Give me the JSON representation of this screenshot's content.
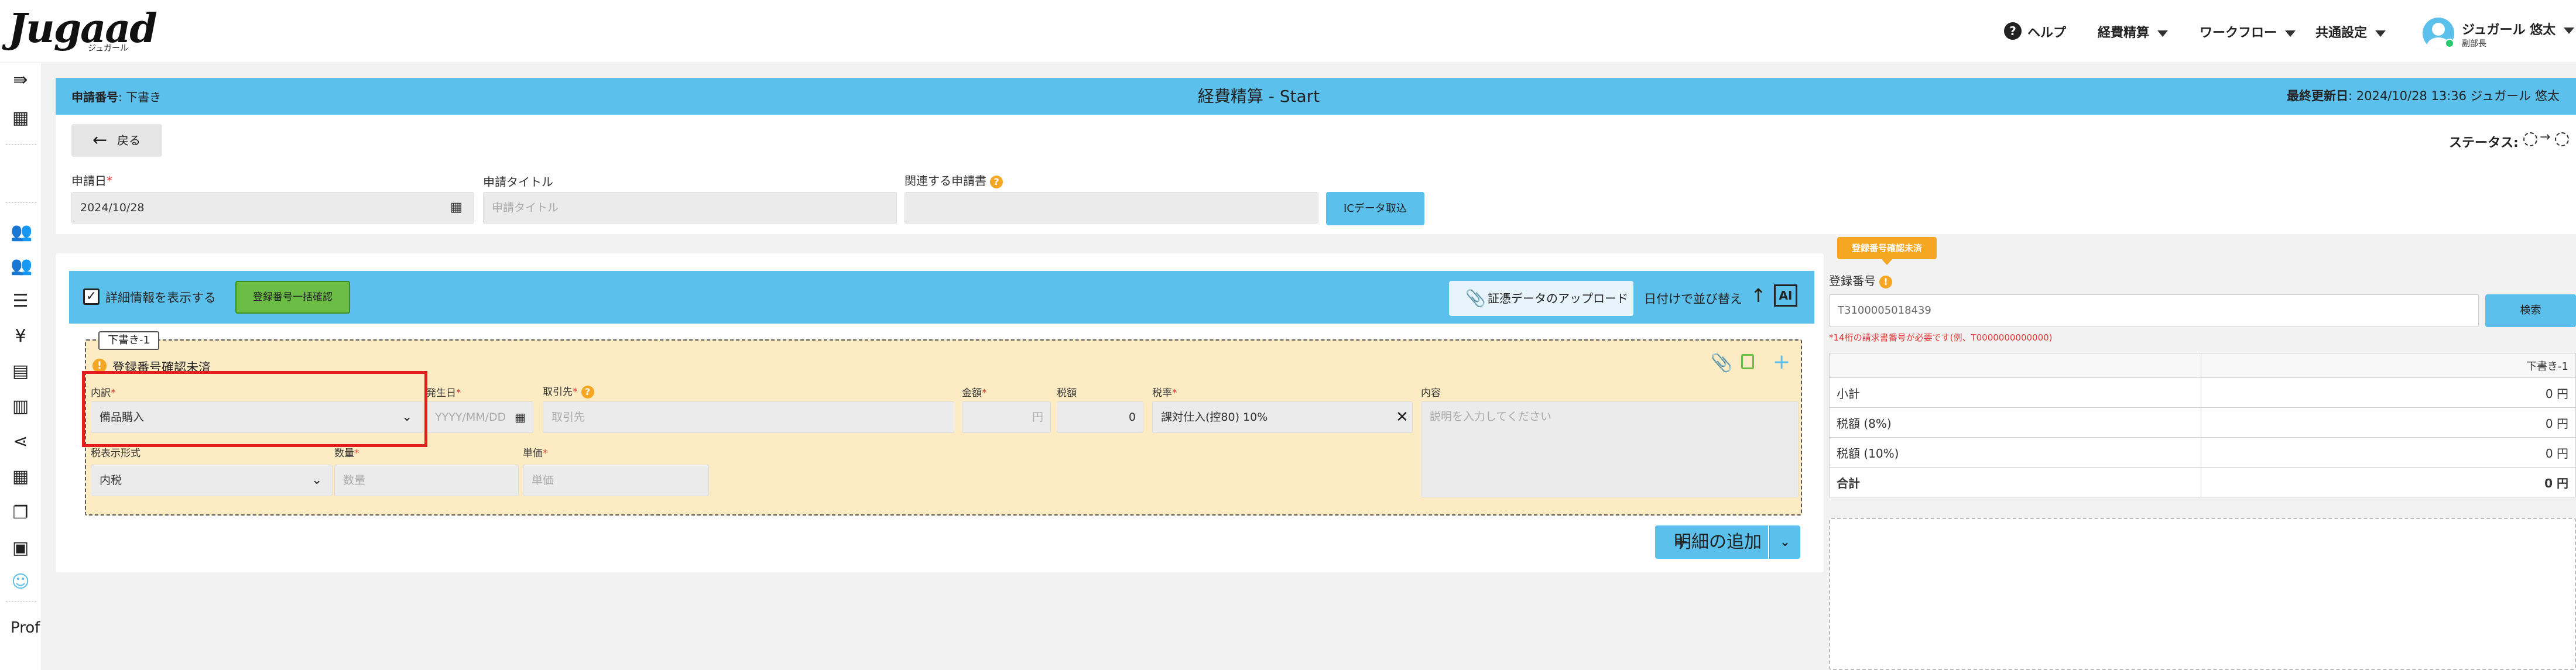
{
  "topbar": {
    "logo_text": "Jugaad",
    "logo_sub": "ジュガール",
    "help_label": "ヘルプ",
    "nav": [
      "経費精算",
      "ワークフロー",
      "共通設定"
    ],
    "user_name": "ジュガール 悠太",
    "user_dept": "副部長"
  },
  "sidebar": {
    "icons": [
      "collapse-icon",
      "building-icon",
      "users-icon",
      "users-icon",
      "list-icon",
      "yen-icon",
      "document-icon",
      "document-stack-icon",
      "share-icon",
      "grid-icon",
      "copy-icon",
      "book-icon",
      "smile-icon"
    ],
    "bottom_text": "Prof"
  },
  "header": {
    "app_no_label": "申請番号",
    "app_no_value": ": 下書き",
    "title": "経費精算 - Start",
    "updated_label": "最終更新日",
    "updated_value": ": 2024/10/28 13:36 ジュガール 悠太"
  },
  "top_form": {
    "back_label": "戻る",
    "status_label": "ステータス:",
    "date_label": "申請日",
    "date_value": "2024/10/28",
    "title_label": "申請タイトル",
    "title_placeholder": "申請タイトル",
    "related_label": "関連する申請書",
    "ic_button": "ICデータ取込"
  },
  "detail": {
    "show_detail_label": "詳細情報を表示する",
    "bulk_confirm_label": "登録番号一括確認",
    "upload_label": "証憑データのアップロード",
    "sort_label": "日付けで並び替え",
    "ai_label": "AI",
    "draft_tag": "下書き-1",
    "warning_text": "登録番号確認未済",
    "fields": {
      "category_label": "内訳",
      "category_value": "備品購入",
      "issue_date_label": "発生日",
      "issue_date_placeholder": "YYYY/MM/DD",
      "vendor_label": "取引先",
      "vendor_placeholder": "取引先",
      "amount_label": "金額",
      "amount_placeholder": "円",
      "tax_label": "税額",
      "tax_value": "0",
      "rate_label": "税率",
      "rate_value": "課対仕入(控80) 10%",
      "content_label": "内容",
      "content_placeholder": "説明を入力してください",
      "tax_display_label": "税表示形式",
      "tax_display_value": "内税",
      "qty_label": "数量",
      "qty_placeholder": "数量",
      "unit_label": "単価",
      "unit_placeholder": "単価"
    },
    "add_line_label": "明細の追加"
  },
  "right_panel": {
    "badge": "登録番号確認未済",
    "reg_label": "登録番号",
    "reg_value": "T3100005018439",
    "search_label": "検索",
    "hint": "*14桁の請求書番号が必要です(例、T0000000000000)",
    "table_header": "下書き-1",
    "rows": [
      {
        "label": "小計",
        "value": "0 円"
      },
      {
        "label": "税額 (8%)",
        "value": "0 円"
      },
      {
        "label": "税額 (10%)",
        "value": "0 円"
      },
      {
        "label": "合計",
        "value": "0 円"
      }
    ]
  },
  "colors": {
    "accent": "#5bc0eb",
    "draft_bg": "#fcebc3",
    "warning": "#f5a623",
    "green": "#6cbd45",
    "highlight": "#e21e1e"
  }
}
